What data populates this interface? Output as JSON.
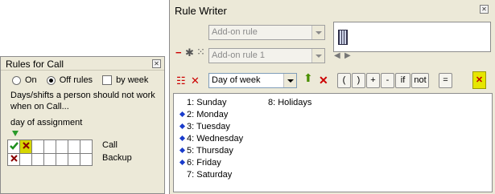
{
  "rules_for_call": {
    "title": "Rules for Call",
    "options": {
      "on_label": "On",
      "off_rules_label": "Off rules",
      "by_week_label": "by week",
      "selected": "Off rules"
    },
    "description": "Days/shifts a person should not work when on Call...",
    "day_of_assignment_label": "day of assignment",
    "rows": [
      {
        "label": "Call"
      },
      {
        "label": "Backup"
      }
    ]
  },
  "rule_writer": {
    "title": "Rule Writer",
    "addon_rule_placeholder": "Add-on rule",
    "addon_rule_1_placeholder": "Add-on rule 1",
    "condition_select_value": "Day of week",
    "operators": [
      "(",
      ")",
      "+",
      "-",
      "if",
      "not",
      "="
    ],
    "list_items": [
      {
        "text": "1: Sunday",
        "marked": false
      },
      {
        "text": "2: Monday",
        "marked": true
      },
      {
        "text": "3: Tuesday",
        "marked": true
      },
      {
        "text": "4: Wednesday",
        "marked": true
      },
      {
        "text": "5: Thursday",
        "marked": true
      },
      {
        "text": "6: Friday",
        "marked": true
      },
      {
        "text": "7: Saturday",
        "marked": false
      },
      {
        "text": "8: Holidays",
        "marked": false
      }
    ]
  },
  "colors": {
    "accent_green": "#2a9a2a",
    "marker_blue": "#1a3ccc",
    "delete_red": "#cc0000",
    "highlight_yellow": "#e6e600"
  }
}
